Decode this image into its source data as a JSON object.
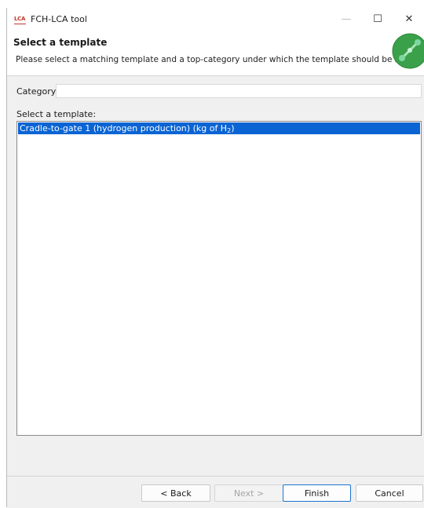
{
  "window": {
    "title": "FCH-LCA tool",
    "app_icon_text": "LCA"
  },
  "controls": {
    "minimize": "—",
    "maximize": "☐",
    "close": "✕"
  },
  "header": {
    "title": "Select a template",
    "description": "Please select a matching template and a top-category under which the template should be stored"
  },
  "form": {
    "category_label": "Category",
    "category_value": "",
    "template_label": "Select a template:"
  },
  "templates": [
    {
      "text": "Cradle-to-gate 1 (hydrogen production) (kg of H",
      "subscript": "2",
      "suffix": ")",
      "selected": true
    }
  ],
  "buttons": {
    "back": "< Back",
    "next": "Next >",
    "finish": "Finish",
    "cancel": "Cancel"
  },
  "colors": {
    "selection": "#0a64d4",
    "primary_border": "#1f73d1"
  }
}
